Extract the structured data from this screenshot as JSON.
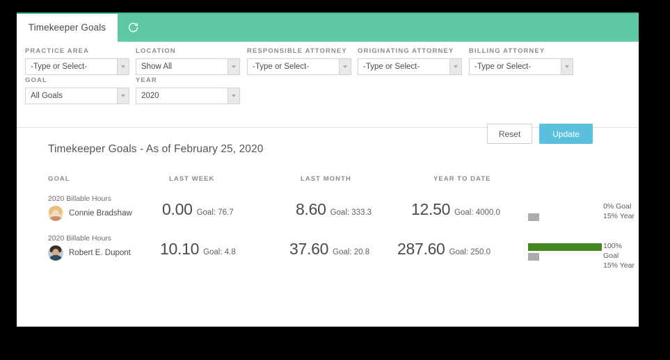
{
  "window": {
    "tab_label": "Timekeeper Goals",
    "refresh_icon": "refresh-icon"
  },
  "filters": {
    "fields": [
      {
        "label": "PRACTICE AREA",
        "value": "-Type or Select-"
      },
      {
        "label": "LOCATION",
        "value": "Show All"
      },
      {
        "label": "RESPONSIBLE ATTORNEY",
        "value": "-Type or Select-"
      },
      {
        "label": "ORIGINATING ATTORNEY",
        "value": "-Type or Select-"
      },
      {
        "label": "BILLING ATTORNEY",
        "value": "-Type or Select-"
      },
      {
        "label": "GOAL",
        "value": "All Goals"
      },
      {
        "label": "YEAR",
        "value": "2020"
      }
    ],
    "reset_label": "Reset",
    "update_label": "Update"
  },
  "report": {
    "title": "Timekeeper Goals - As of February 25, 2020",
    "columns": [
      "GOAL",
      "LAST WEEK",
      "LAST MONTH",
      "YEAR TO DATE"
    ],
    "rows": [
      {
        "goal_name": "2020 Billable Hours",
        "person": "Connie Bradshaw",
        "avatar": "avatar-connie-bradshaw",
        "last_week": {
          "value": "0.00",
          "goal": "Goal: 76.7"
        },
        "last_month": {
          "value": "8.60",
          "goal": "Goal: 333.3"
        },
        "year_to_date": {
          "value": "12.50",
          "goal": "Goal: 4000.0"
        },
        "goal_percent": 0,
        "year_percent": 15,
        "goal_label": "0% Goal",
        "year_label": "15% Year"
      },
      {
        "goal_name": "2020 Billable Hours",
        "person": "Robert E. Dupont",
        "avatar": "avatar-robert-dupont",
        "last_week": {
          "value": "10.10",
          "goal": "Goal: 4.8"
        },
        "last_month": {
          "value": "37.60",
          "goal": "Goal: 20.8"
        },
        "year_to_date": {
          "value": "287.60",
          "goal": "Goal: 250.0"
        },
        "goal_percent": 100,
        "year_percent": 15,
        "goal_label": "100% Goal",
        "year_label": "15% Year"
      }
    ]
  },
  "colors": {
    "header_teal": "#5ec9a3",
    "update_blue": "#5bc0de",
    "bar_green": "#42891f",
    "bar_gray": "#ababab"
  }
}
